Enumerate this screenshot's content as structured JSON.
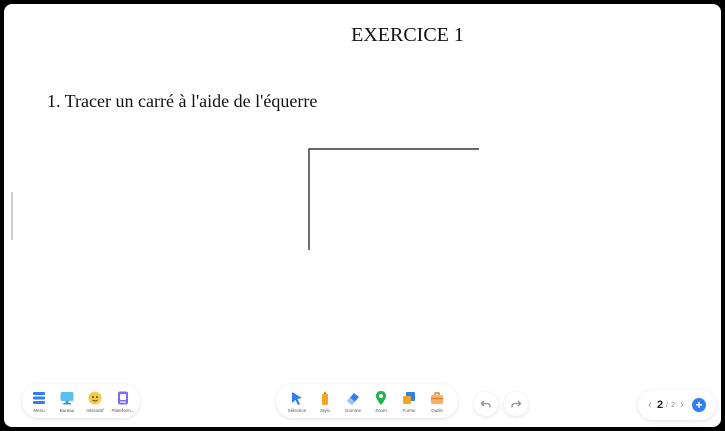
{
  "title": "EXERCICE 1",
  "instruction": "1. Tracer un carré à l'aide de l'équerre",
  "toolbar_left": [
    {
      "label": "Menu",
      "icon": "menu-icon"
    },
    {
      "label": "Bureau",
      "icon": "desktop-icon"
    },
    {
      "label": "Interactif",
      "icon": "interactive-icon"
    },
    {
      "label": "Plateform...",
      "icon": "platform-icon"
    }
  ],
  "toolbar_center": [
    {
      "label": "Sélection",
      "icon": "cursor-icon"
    },
    {
      "label": "Stylo",
      "icon": "pen-icon"
    },
    {
      "label": "Gomme",
      "icon": "eraser-icon"
    },
    {
      "label": "Zoom",
      "icon": "zoom-pin-icon"
    },
    {
      "label": "Forme",
      "icon": "shape-icon"
    },
    {
      "label": "Outils",
      "icon": "tools-icon"
    }
  ],
  "pagination": {
    "current": "2",
    "separator": "/",
    "total": "2"
  },
  "colors": {
    "accent": "#2f7ef5",
    "stroke": "#333333",
    "pen": "#f5a524",
    "zoom": "#22b14c"
  }
}
